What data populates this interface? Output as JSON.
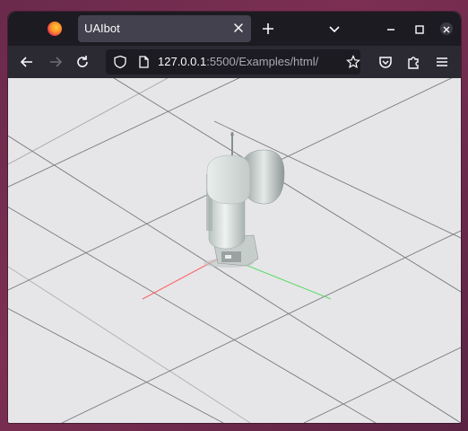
{
  "browser": {
    "tab_title": "UAIbot",
    "url_host": "127.0.0.1",
    "url_rest": ":5500/Examples/html/"
  },
  "icons": {
    "browser_logo": "firefox-logo-icon",
    "tab_close": "close-icon",
    "new_tab": "plus-icon",
    "tab_list": "chevron-down-icon",
    "minimize": "minimize-icon",
    "maximize": "maximize-icon",
    "close_window": "close-icon",
    "back": "arrow-left-icon",
    "forward": "arrow-right-icon",
    "reload": "reload-icon",
    "tracking": "shield-icon",
    "page_info": "page-icon",
    "bookmark": "star-icon",
    "pocket": "pocket-icon",
    "extensions": "puzzle-icon",
    "menu": "hamburger-icon"
  },
  "colors": {
    "tabbar": "#1c1b22",
    "navbar": "#2b2a33",
    "scene_background": "#e6e6e9",
    "grid_line": "#3a3a3a",
    "robot_body": "#d8dfdc",
    "axis_x": "#ff3b3b",
    "axis_y": "#3bd13b"
  }
}
